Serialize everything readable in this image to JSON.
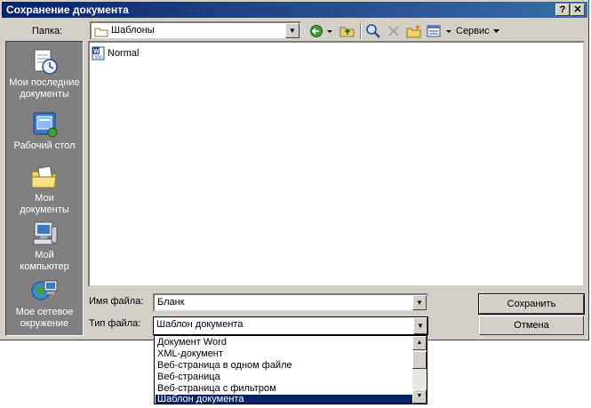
{
  "window": {
    "title": "Сохранение документа",
    "help_label": "?",
    "close_label": "✕"
  },
  "toolbar": {
    "folder_label": "Папка:",
    "folder_value": "Шаблоны",
    "service_label": "Сервис"
  },
  "places": [
    {
      "label_line1": "Мои последние",
      "label_line2": "документы",
      "icon": "recent-docs-icon"
    },
    {
      "label_line1": "Рабочий стол",
      "label_line2": "",
      "icon": "desktop-icon"
    },
    {
      "label_line1": "Мои",
      "label_line2": "документы",
      "icon": "my-documents-icon"
    },
    {
      "label_line1": "Мой",
      "label_line2": "компьютер",
      "icon": "my-computer-icon"
    },
    {
      "label_line1": "Мое сетевое",
      "label_line2": "окружение",
      "icon": "network-icon"
    }
  ],
  "files": [
    {
      "name": "Normal",
      "icon": "word-doc-icon"
    }
  ],
  "form": {
    "filename_label": "Имя файла:",
    "filename_value": "Бланк",
    "filetype_label": "Тип файла:",
    "filetype_value": "Шаблон документа"
  },
  "buttons": {
    "save_label": "Сохранить",
    "cancel_label": "Отмена"
  },
  "filetype_options": [
    "Документ Word",
    "XML-документ",
    "Веб-страница в одном файле",
    "Веб-страница",
    "Веб-страница с фильтром",
    "Шаблон документа"
  ],
  "colors": {
    "titlebar": "#0a246a",
    "selection": "#0a246a",
    "dialog_bg": "#d4d0c8"
  }
}
